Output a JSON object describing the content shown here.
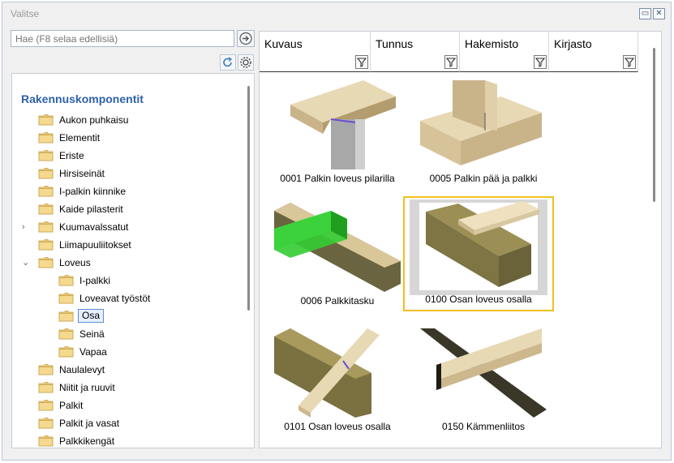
{
  "window": {
    "title": "Valitse"
  },
  "search": {
    "placeholder": "Hae (F8 selaa edellisiä)"
  },
  "tree": {
    "heading": "Rakennuskomponentit",
    "items": [
      {
        "label": "Aukon puhkaisu",
        "level": 0
      },
      {
        "label": "Elementit",
        "level": 0
      },
      {
        "label": "Eriste",
        "level": 0
      },
      {
        "label": "Hirsiseinät",
        "level": 0
      },
      {
        "label": "I-palkin kiinnike",
        "level": 0
      },
      {
        "label": "Kaide pilasterit",
        "level": 0
      },
      {
        "label": "Kuumavalssatut",
        "level": 0,
        "expander": "collapsed"
      },
      {
        "label": "Liimapuuliitokset",
        "level": 0
      },
      {
        "label": "Loveus",
        "level": 0,
        "expander": "expanded"
      },
      {
        "label": "I-palkki",
        "level": 1
      },
      {
        "label": "Loveavat työstöt",
        "level": 1
      },
      {
        "label": "Osa",
        "level": 1,
        "selected": true
      },
      {
        "label": "Seinä",
        "level": 1
      },
      {
        "label": "Vapaa",
        "level": 1
      },
      {
        "label": "Naulalevyt",
        "level": 0
      },
      {
        "label": "Niitit ja ruuvit",
        "level": 0
      },
      {
        "label": "Palkit",
        "level": 0
      },
      {
        "label": "Palkit ja vasat",
        "level": 0
      },
      {
        "label": "Palkkikengät",
        "level": 0
      }
    ]
  },
  "columns": [
    "Kuvaus",
    "Tunnus",
    "Hakemisto",
    "Kirjasto"
  ],
  "thumbnails": [
    {
      "caption": "0001 Palkin loveus pilarilla"
    },
    {
      "caption": "0005 Palkin pää ja palkki"
    },
    {
      "caption": "0006 Palkkitasku"
    },
    {
      "caption": "0100 Osan loveus osalla",
      "selected": true
    },
    {
      "caption": "0101 Osan loveus osalla"
    },
    {
      "caption": "0150 Kämmenliitos"
    }
  ],
  "colors": {
    "heading": "#2e62a8",
    "wood_light": "#e2cfa6",
    "wood_olive": "#857a45",
    "steel": "#b0b0b0",
    "green": "#2fbf2f",
    "selection": "#f0c020"
  }
}
